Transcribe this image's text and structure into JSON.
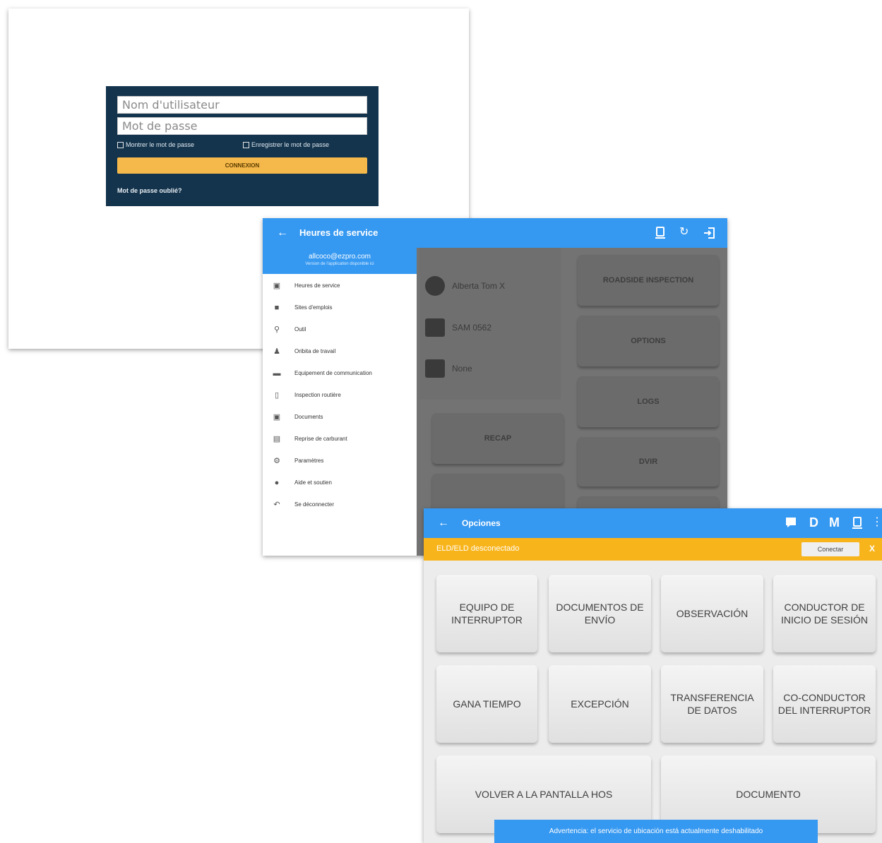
{
  "login": {
    "username_placeholder": "Nom d'utilisateur",
    "password_placeholder": "Mot de passe",
    "show_password_label": "Montrer le mot de passe",
    "save_password_label": "Enregistrer le mot de passe",
    "login_button_label": "CONNEXION",
    "forgot_password_label": "Mot de passe oublié?"
  },
  "hos": {
    "title": "Heures de service",
    "toolbar_icons": [
      "back-arrow-icon",
      "device-icon",
      "refresh-icon",
      "logout-icon"
    ],
    "drawer": {
      "email": "allcoco@ezpro.com",
      "subtext": "Version de l'application disponible ici",
      "items": [
        {
          "icon": "calendar-icon",
          "label": "Heures de service"
        },
        {
          "icon": "truck-icon",
          "label": "Sites d'emplois"
        },
        {
          "icon": "search-icon",
          "label": "Outil"
        },
        {
          "icon": "person-icon",
          "label": "Oribita de travail"
        },
        {
          "icon": "truck-icon",
          "label": "Equipement de communication"
        },
        {
          "icon": "document-icon",
          "label": "Inspection routière"
        },
        {
          "icon": "document-icon",
          "label": "Documents"
        },
        {
          "icon": "lock-icon",
          "label": "Reprise de carburant"
        },
        {
          "icon": "gear-icon",
          "label": "Paramètres"
        },
        {
          "icon": "help-icon",
          "label": "Aide et soutien"
        },
        {
          "icon": "logout-icon",
          "label": "Se déconnecter"
        }
      ]
    },
    "background": {
      "user_name": "Alberta Tom X",
      "vehicle": "SAM 0562",
      "trailer": "None",
      "buttons": {
        "inspection": "ROADSIDE INSPECTION",
        "options": "OPTIONS",
        "logs": "LOGS",
        "dvir": "DVIR",
        "recap": "RECAP",
        "more": "",
        "more2": ""
      }
    }
  },
  "options": {
    "title": "Opciones",
    "toolbar_letters": {
      "d": "D",
      "m": "M"
    },
    "status_text": "ELD/ELD desconectado",
    "connect_button": "Conectar",
    "close_symbol": "X",
    "buttons": [
      "EQUIPO DE INTERRUPTOR",
      "DOCUMENTOS DE ENVÍO",
      "OBSERVACIÓN",
      "CONDUCTOR DE INICIO DE SESIÓN",
      "GANA TIEMPO",
      "EXCEPCIÓN",
      "TRANSFERENCIA DE DATOS",
      "CO-CONDUCTOR DEL INTERRUPTOR",
      "VOLVER A LA PANTALLA HOS",
      "DOCUMENTO"
    ],
    "toast": "Advertencia: el servicio de ubicación está actualmente deshabilitado"
  },
  "colors": {
    "toolbar_blue": "#3598f1",
    "login_navy": "#14344d",
    "login_button": "#f5b84a",
    "status_yellow": "#f8b41b"
  }
}
